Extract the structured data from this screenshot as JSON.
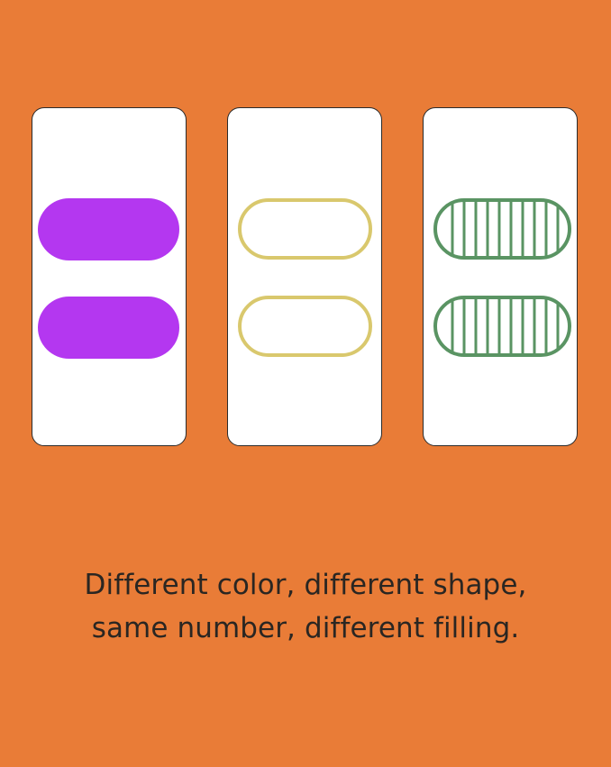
{
  "cards": [
    {
      "color": "#b437f0",
      "shape": "pill",
      "filling": "solid",
      "number": 2
    },
    {
      "color": "#d9c86d",
      "shape": "pill",
      "filling": "empty",
      "number": 2
    },
    {
      "color": "#5a9463",
      "shape": "pill",
      "filling": "striped",
      "number": 2
    }
  ],
  "caption": {
    "line1": "Different color, different shape,",
    "line2": "same number, different filling."
  }
}
